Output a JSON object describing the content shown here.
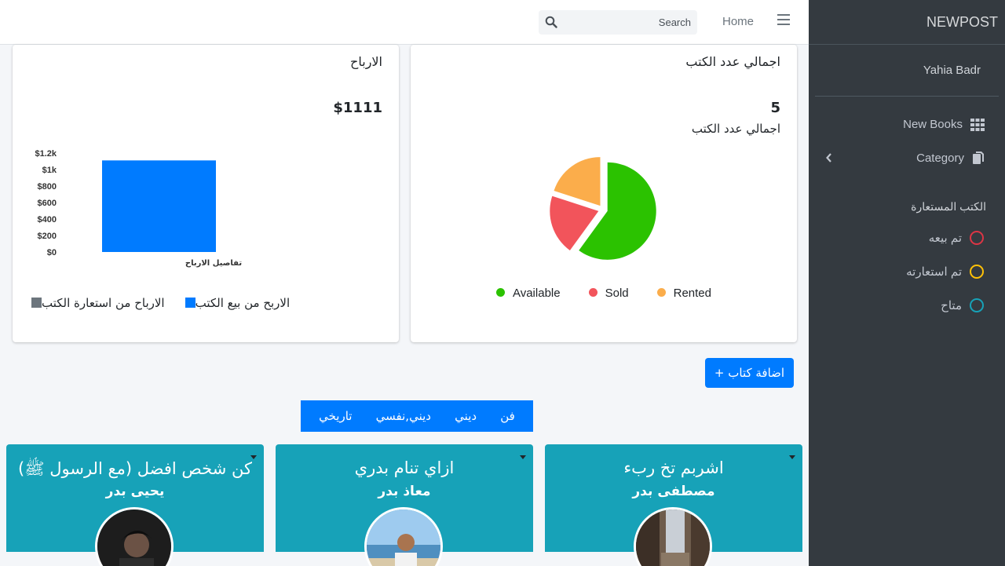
{
  "sidebar": {
    "brand": "NEWPOST",
    "user_name": "Yahia Badr",
    "items": [
      {
        "label": "New Books",
        "icon": "grid-icon"
      },
      {
        "label": "Category",
        "icon": "copy-icon"
      }
    ],
    "header": "الكتب المستعارة",
    "legend": [
      {
        "label": "تم بيعه",
        "color": "#dc3545"
      },
      {
        "label": "تم استعارته",
        "color": "#ffc107"
      },
      {
        "label": "متاح",
        "color": "#17a2b8"
      }
    ]
  },
  "navbar": {
    "home": "Home",
    "search_placeholder": "Search"
  },
  "profits_card": {
    "title": "الارباح",
    "total": "$1111",
    "legend": [
      {
        "label": "الاربح من بيع الكتب",
        "color": "#007bff"
      },
      {
        "label": "الارباح من استعارة الكتب",
        "color": "#6c757d"
      }
    ]
  },
  "books_card": {
    "title": "اجمالي عدد الكتب",
    "count": "5",
    "subtitle": "اجمالي عدد الكتب"
  },
  "chart_data": [
    {
      "type": "bar",
      "categories": [
        "تفاصيل الارباح"
      ],
      "series": [
        {
          "name": "الاربح من بيع الكتب",
          "values": [
            1111
          ],
          "color": "#007bff"
        }
      ],
      "ylim": [
        0,
        1200
      ],
      "yticks": [
        "$0",
        "$200",
        "$400",
        "$600",
        "$800",
        "$1k",
        "$1.2k"
      ]
    },
    {
      "type": "pie",
      "labels": [
        "Available",
        "Sold",
        "Rented"
      ],
      "values": [
        3,
        1,
        1
      ],
      "colors": [
        "#2bc200",
        "#f2545b",
        "#fbad4b"
      ]
    }
  ],
  "add_button": "+ اضافة كتاب",
  "tabs": [
    "فن",
    "ديني",
    "ديني,نفسي",
    "تاريخي"
  ],
  "books": [
    {
      "title": "اشربم تخ ربء",
      "author": "مصطفى بدر"
    },
    {
      "title": "ازاي تنام بدري",
      "author": "معاذ بدر"
    },
    {
      "title": "كن شخص افضل (مع الرسول ﷺ)",
      "author": "يحيى بدر"
    }
  ]
}
